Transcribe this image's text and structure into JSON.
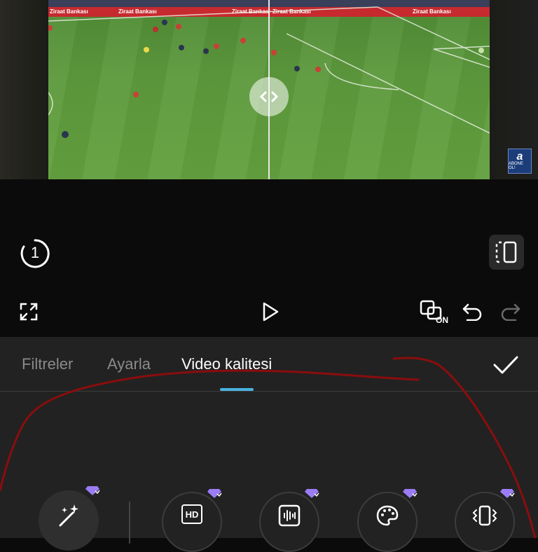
{
  "video": {
    "ad_boards": [
      "Ziraat Bankası",
      "Ziraat Bankası",
      "Ziraat Bankası",
      "Ziraat Bankası",
      "Ziraat Bankası"
    ],
    "watermark_letter": "a",
    "watermark_label": "ABONE OL!"
  },
  "undo_counter": "1",
  "controls": {
    "compare_on_label": "ON"
  },
  "tabs": [
    {
      "label": "Filtreler"
    },
    {
      "label": "Ayarla"
    },
    {
      "label": "Video kalitesi"
    }
  ],
  "tools": [
    {
      "icon": "magic-wand-icon",
      "pro": true
    },
    {
      "icon": "hd-icon",
      "label": "HD",
      "pro": true
    },
    {
      "icon": "noise-reduction-icon",
      "pro": true
    },
    {
      "icon": "palette-icon",
      "pro": true
    },
    {
      "icon": "stabilize-icon",
      "pro": true
    }
  ],
  "colors": {
    "accent": "#4ab3e0",
    "pro_badge": "#9b7cf5",
    "annotation": "#8b0d0d"
  }
}
